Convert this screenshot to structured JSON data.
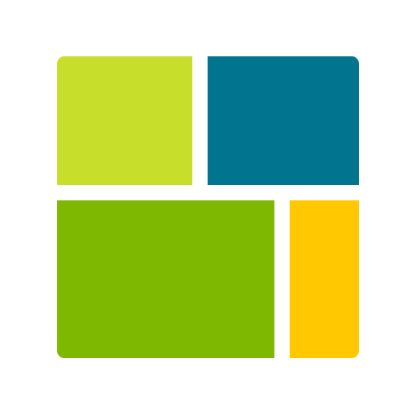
{
  "logo": {
    "icon": "tile-grid-logo-icon",
    "tiles": [
      {
        "name": "lime",
        "color": "#C7DE2B"
      },
      {
        "name": "teal",
        "color": "#01758F"
      },
      {
        "name": "green",
        "color": "#7FB800"
      },
      {
        "name": "yellow",
        "color": "#FFC800"
      }
    ]
  }
}
